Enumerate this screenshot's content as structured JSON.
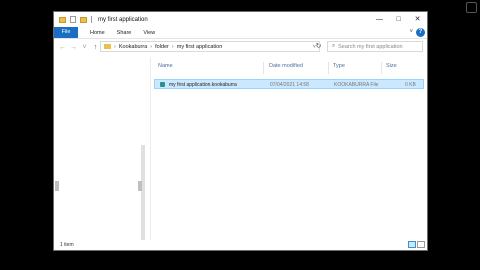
{
  "window": {
    "title": "my first application",
    "controls": {
      "minimize": "—",
      "maximize": "□",
      "close": "✕"
    }
  },
  "ribbon": {
    "tabs": [
      "File",
      "Home",
      "Share",
      "View"
    ],
    "help": "?"
  },
  "nav": {
    "back": "←",
    "forward": "→",
    "recent": "˅",
    "up": "↑"
  },
  "address": {
    "crumbs": [
      "Kookaburra",
      "folder",
      "my first application"
    ],
    "separator": "›",
    "dropdown": "˅",
    "refresh": "↻"
  },
  "search": {
    "placeholder": "Search my first application",
    "icon": "⌕"
  },
  "columns": [
    "Name",
    "Date modified",
    "Type",
    "Size"
  ],
  "files": [
    {
      "name": "my first application.kookaburra",
      "date": "07/04/2021 14:58",
      "type": "KOOKABURRA File",
      "size": "0 KB"
    }
  ],
  "status": {
    "count": "1 item"
  },
  "colors": {
    "accent": "#1a6fc4",
    "selection": "#cce8ff",
    "folder": "#e8c14f"
  }
}
